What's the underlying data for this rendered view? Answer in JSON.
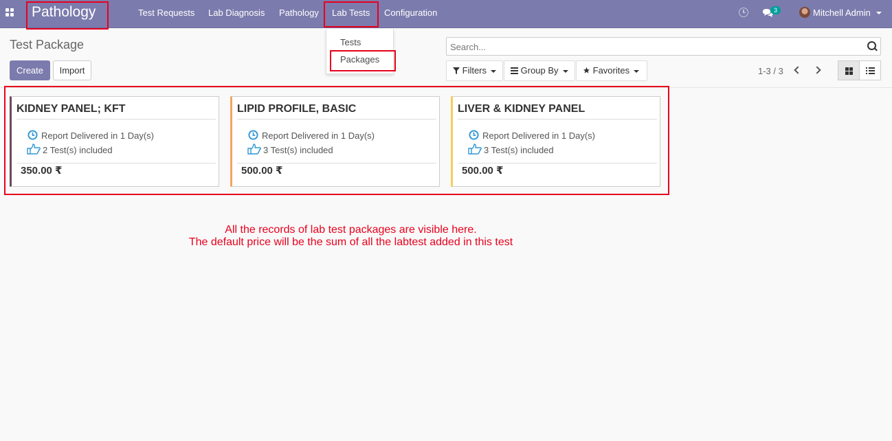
{
  "navbar": {
    "brand": "Pathology",
    "menu": [
      "Test Requests",
      "Lab Diagnosis",
      "Pathology",
      "Lab Tests",
      "Configuration"
    ],
    "chat_count": "3",
    "user_name": "Mitchell Admin"
  },
  "dropdown": {
    "items": [
      "Tests",
      "Packages"
    ]
  },
  "control_panel": {
    "title": "Test Package",
    "create_label": "Create",
    "import_label": "Import",
    "search_placeholder": "Search...",
    "filters_label": "Filters",
    "group_by_label": "Group By",
    "favorites_label": "Favorites",
    "pager": "1-3 / 3"
  },
  "cards": [
    {
      "title": "KIDNEY PANEL; KFT",
      "delivery": "Report Delivered in 1 Day(s)",
      "tests": "2 Test(s) included",
      "price": "350.00 ₹",
      "color": "#6c4b5e"
    },
    {
      "title": "LIPID PROFILE, BASIC",
      "delivery": "Report Delivered in 1 Day(s)",
      "tests": "3 Test(s) included",
      "price": "500.00 ₹",
      "color": "#f4a460"
    },
    {
      "title": "LIVER & KIDNEY PANEL",
      "delivery": "Report Delivered in 1 Day(s)",
      "tests": "3 Test(s) included",
      "price": "500.00 ₹",
      "color": "#f7cd58"
    }
  ],
  "annotation": {
    "line1": "All the records of lab test packages are visible here.",
    "line2": "The default price will be the sum of all the labtest added in this test"
  },
  "colors": {
    "navbar": "#7c7bad",
    "highlight": "#e8001c",
    "icon_blue": "#2f96d6"
  }
}
